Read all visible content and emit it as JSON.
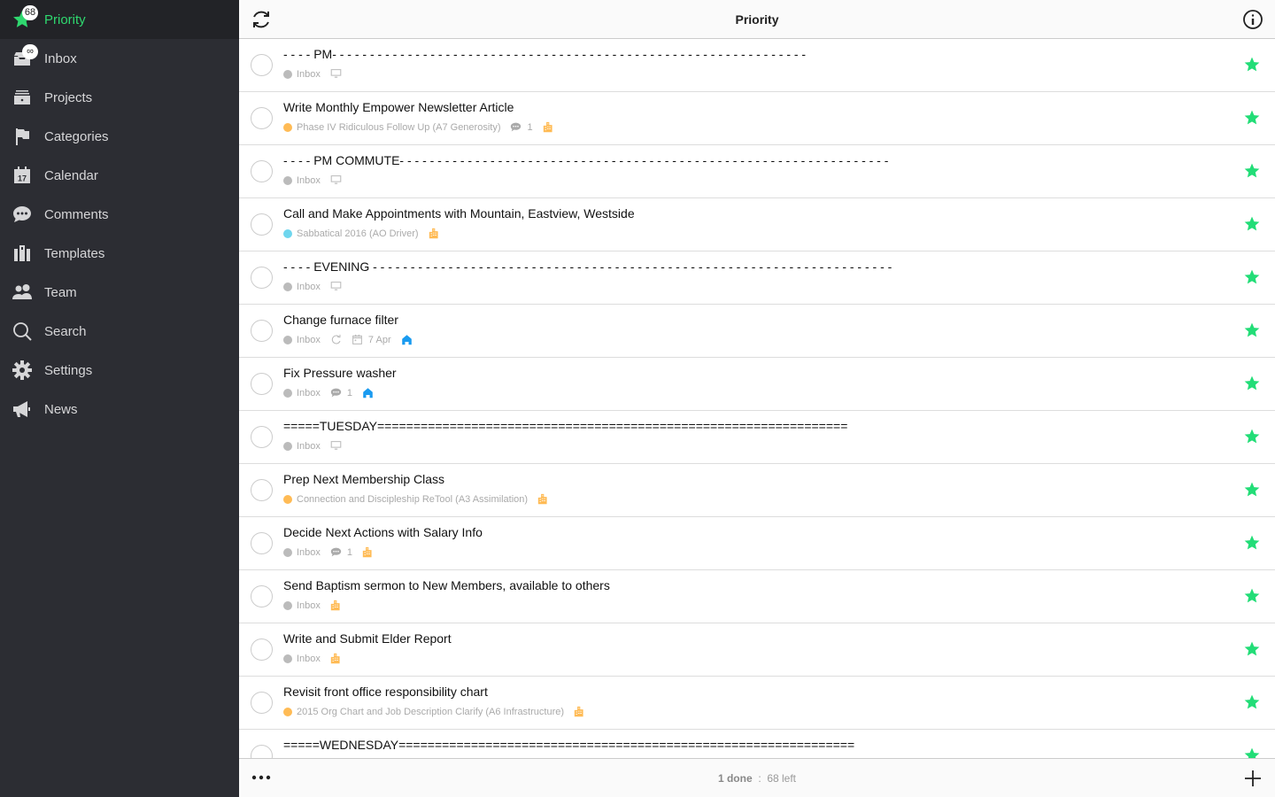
{
  "sidebar": {
    "items": [
      {
        "label": "Priority",
        "icon": "star-icon",
        "badge": "68",
        "active": true
      },
      {
        "label": "Inbox",
        "icon": "inbox-icon",
        "badge": "∞"
      },
      {
        "label": "Projects",
        "icon": "projects-icon"
      },
      {
        "label": "Categories",
        "icon": "flag-icon"
      },
      {
        "label": "Calendar",
        "icon": "calendar-icon",
        "icon_text": "17"
      },
      {
        "label": "Comments",
        "icon": "comments-icon"
      },
      {
        "label": "Templates",
        "icon": "templates-icon"
      },
      {
        "label": "Team",
        "icon": "team-icon"
      },
      {
        "label": "Search",
        "icon": "search-icon"
      },
      {
        "label": "Settings",
        "icon": "gear-icon"
      },
      {
        "label": "News",
        "icon": "megaphone-icon"
      }
    ]
  },
  "header": {
    "title": "Priority",
    "left_icon": "refresh-icon",
    "right_icon": "info-icon"
  },
  "colors": {
    "accent": "#2fd86f",
    "star": "#22dd77",
    "orange": "#ffbb55",
    "cyan": "#6fd6ee",
    "gray": "#bbbbbb",
    "home": "#1a9bf0"
  },
  "tasks": [
    {
      "title": "- - - - PM- - - - - - - - - - - - - - - - - - - - - - - - - - - - - - - - - - - - - - - - - - - - - - - - - - - - - - - - - - - - - - -",
      "meta": [
        {
          "type": "project",
          "label": "Inbox",
          "color": "gray"
        },
        {
          "type": "monitor"
        }
      ]
    },
    {
      "title": "Write Monthly Empower Newsletter Article",
      "meta": [
        {
          "type": "project",
          "label": "Phase IV Ridiculous Follow Up (A7 Generosity)",
          "color": "orange"
        },
        {
          "type": "comment",
          "count": "1"
        },
        {
          "type": "building"
        }
      ]
    },
    {
      "title": "- - - - PM COMMUTE- - - - - - - - - - - - - - - - - - - - - - - - - - - - - - - - - - - - - - - - - - - - - - - - - - - - - - - - - - - - - - - - -",
      "meta": [
        {
          "type": "project",
          "label": "Inbox",
          "color": "gray"
        },
        {
          "type": "monitor"
        }
      ]
    },
    {
      "title": "Call and Make Appointments with Mountain, Eastview, Westside",
      "meta": [
        {
          "type": "project",
          "label": "Sabbatical 2016 (AO Driver)",
          "color": "cyan"
        },
        {
          "type": "building"
        }
      ]
    },
    {
      "title": "- - - - EVENING - - - - - - - - - - - - - - - - - - - - - - - - - - - - - - - - - - - - - - - - - - - - - - - - - - - - - - - - - - - - - - - - - - - - -",
      "meta": [
        {
          "type": "project",
          "label": "Inbox",
          "color": "gray"
        },
        {
          "type": "monitor"
        }
      ]
    },
    {
      "title": "Change furnace filter",
      "meta": [
        {
          "type": "project",
          "label": "Inbox",
          "color": "gray"
        },
        {
          "type": "repeat"
        },
        {
          "type": "date",
          "label": "7 Apr"
        },
        {
          "type": "home"
        }
      ]
    },
    {
      "title": "Fix Pressure washer",
      "meta": [
        {
          "type": "project",
          "label": "Inbox",
          "color": "gray"
        },
        {
          "type": "comment",
          "count": "1"
        },
        {
          "type": "home"
        }
      ]
    },
    {
      "title": "=====TUESDAY=================================================================",
      "meta": [
        {
          "type": "project",
          "label": "Inbox",
          "color": "gray"
        },
        {
          "type": "monitor"
        }
      ]
    },
    {
      "title": "Prep Next Membership Class",
      "meta": [
        {
          "type": "project",
          "label": "Connection and Discipleship ReTool (A3 Assimilation)",
          "color": "orange"
        },
        {
          "type": "building"
        }
      ]
    },
    {
      "title": "Decide Next Actions with Salary Info",
      "meta": [
        {
          "type": "project",
          "label": "Inbox",
          "color": "gray"
        },
        {
          "type": "comment",
          "count": "1"
        },
        {
          "type": "building"
        }
      ]
    },
    {
      "title": "Send Baptism sermon to New Members, available to others",
      "meta": [
        {
          "type": "project",
          "label": "Inbox",
          "color": "gray"
        },
        {
          "type": "building"
        }
      ]
    },
    {
      "title": "Write and Submit Elder Report",
      "meta": [
        {
          "type": "project",
          "label": "Inbox",
          "color": "gray"
        },
        {
          "type": "building"
        }
      ]
    },
    {
      "title": "Revisit front office responsibility chart",
      "meta": [
        {
          "type": "project",
          "label": "2015 Org Chart and Job Description Clarify (A6 Infrastructure)",
          "color": "orange"
        },
        {
          "type": "building"
        }
      ]
    },
    {
      "title": "=====WEDNESDAY===============================================================",
      "meta": []
    }
  ],
  "footer": {
    "menu_icon": "more-icon",
    "done": "1 done",
    "separator": ":",
    "left": "68 left",
    "add_icon": "plus-icon"
  }
}
